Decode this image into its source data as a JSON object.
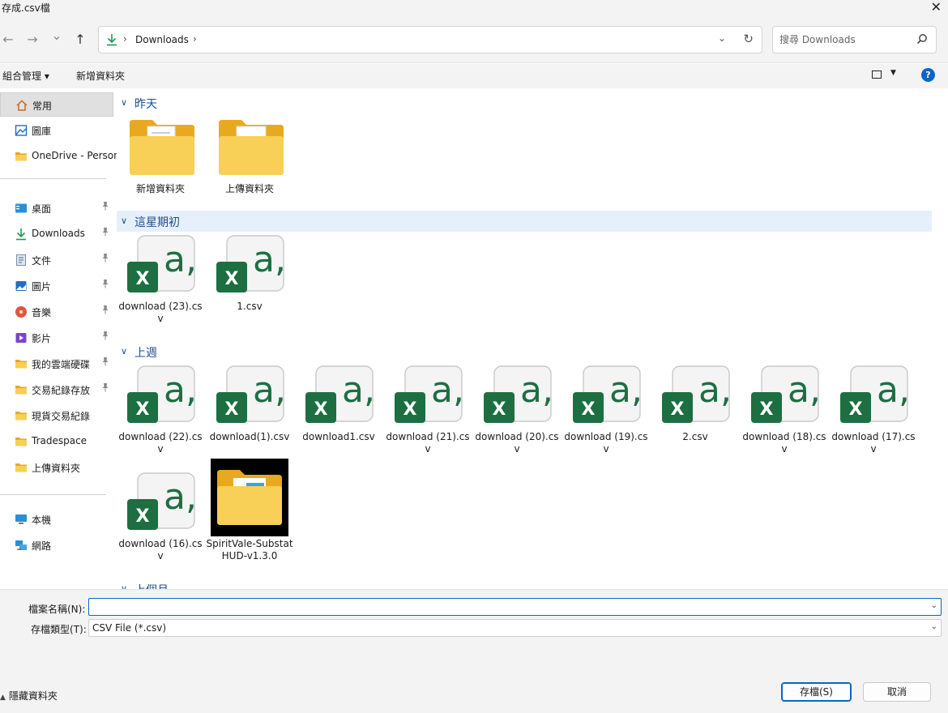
{
  "window": {
    "title": "存成.csv檔",
    "close_glyph": "✕"
  },
  "nav": {
    "back_glyph": "←",
    "forward_glyph": "→",
    "recent_glyph": "⌄",
    "up_glyph": "↑",
    "breadcrumb": "Downloads",
    "search_placeholder": "搜尋 Downloads"
  },
  "toolbar": {
    "organize": "組合管理 ▾",
    "new_folder": "新增資料夾",
    "help": "?"
  },
  "sidebar": {
    "items": [
      {
        "label": "常用",
        "icon": "home-icon"
      },
      {
        "label": "圖庫",
        "icon": "gallery-icon"
      },
      {
        "label": "OneDrive - Person",
        "icon": "folder-icon"
      },
      {
        "label": "桌面",
        "icon": "desktop-icon"
      },
      {
        "label": "Downloads",
        "icon": "download-icon"
      },
      {
        "label": "文件",
        "icon": "document-icon"
      },
      {
        "label": "圖片",
        "icon": "picture-icon"
      },
      {
        "label": "音樂",
        "icon": "music-icon"
      },
      {
        "label": "影片",
        "icon": "video-icon"
      },
      {
        "label": "我的雲端硬碟",
        "icon": "folder-icon"
      },
      {
        "label": "交易紀錄存放",
        "icon": "folder-icon"
      },
      {
        "label": "現貨交易紀錄",
        "icon": "folder-icon"
      },
      {
        "label": "Tradespace",
        "icon": "folder-icon"
      },
      {
        "label": "上傳資料夾",
        "icon": "folder-icon"
      },
      {
        "label": "本機",
        "icon": "computer-icon"
      },
      {
        "label": "網路",
        "icon": "network-icon"
      }
    ]
  },
  "groups": [
    {
      "label": "昨天",
      "items": [
        "新增資料夾",
        "上傳資料夾"
      ]
    },
    {
      "label": "這星期初",
      "items": [
        "download (23).csv",
        "1.csv"
      ]
    },
    {
      "label": "上週",
      "items": [
        "download (22).csv",
        "download(1).csv",
        "download1.csv",
        "download (21).csv",
        "download (20).csv",
        "download (19).csv",
        "2.csv",
        "download (18).csv",
        "download (17).csv",
        "download (16).csv",
        "SpiritVale-SubstatHUD-v1.3.0"
      ]
    },
    {
      "label": "上個月",
      "items": []
    }
  ],
  "form": {
    "filename_label": "檔案名稱(N):",
    "filename_value": "",
    "filetype_label": "存檔類型(T):",
    "filetype_value": "CSV File (*.csv)"
  },
  "buttons": {
    "hide_folders": "隱藏資料夾",
    "save": "存檔(S)",
    "cancel": "取消"
  },
  "colors": {
    "accent": "#0a64c8",
    "folder": "#f5c242",
    "excel": "#1d6f42",
    "csv_glyph": "#1d6f42"
  }
}
